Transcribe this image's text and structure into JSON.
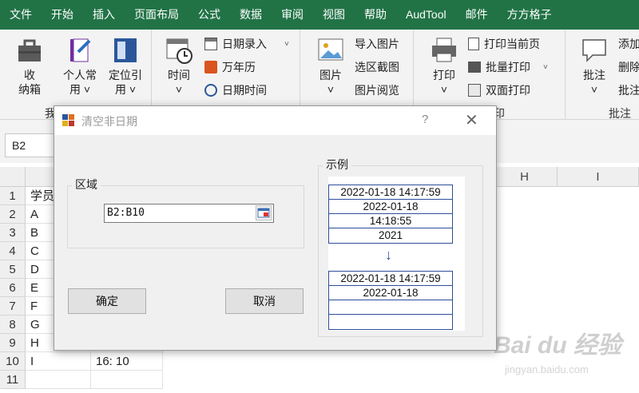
{
  "menu_tabs": [
    "文件",
    "开始",
    "插入",
    "页面布局",
    "公式",
    "数据",
    "审阅",
    "视图",
    "帮助",
    "AudTool",
    "邮件",
    "方方格子"
  ],
  "ribbon": {
    "toolbox": {
      "label": "收\n纳箱"
    },
    "personal": {
      "label": "个人常\n用 ˅"
    },
    "locate": {
      "label": "定位引\n用 ˅"
    },
    "group1_label": "我",
    "time": {
      "label": "时间\n˅"
    },
    "date_entry": "日期录入",
    "calendar": "万年历",
    "datetime": "日期时间",
    "picture": {
      "label": "图片\n˅"
    },
    "import_pic": "导入图片",
    "select_screenshot": "选区截图",
    "pic_browse": "图片阅览",
    "print": {
      "label": "打印\n˅"
    },
    "print_current": "打印当前页",
    "batch_print": "批量打印",
    "duplex_print": "双面打印",
    "print_group_label": "印",
    "comment": {
      "label": "批注\n˅"
    },
    "add": "添加",
    "delete": "删除",
    "comment_short": "批注",
    "comment_group_label": "批注"
  },
  "namebox": "B2",
  "columns": [
    "H",
    "I"
  ],
  "rows": [
    {
      "num": "1",
      "a": "学员",
      "b": ""
    },
    {
      "num": "2",
      "a": "A",
      "b": ""
    },
    {
      "num": "3",
      "a": "B",
      "b": ""
    },
    {
      "num": "4",
      "a": "C",
      "b": ""
    },
    {
      "num": "5",
      "a": "D",
      "b": ""
    },
    {
      "num": "6",
      "a": "E",
      "b": ""
    },
    {
      "num": "7",
      "a": "F",
      "b": ""
    },
    {
      "num": "8",
      "a": "G",
      "b": ""
    },
    {
      "num": "9",
      "a": "H",
      "b": ""
    },
    {
      "num": "10",
      "a": "I",
      "b": "16:  10"
    },
    {
      "num": "11",
      "a": "",
      "b": ""
    }
  ],
  "dialog": {
    "title": "清空非日期",
    "help": "?",
    "close": "✕",
    "region_legend": "区域",
    "range_value": "B2:B10",
    "ok": "确定",
    "cancel": "取消",
    "example_legend": "示例",
    "before": [
      "2022-01-18 14:17:59",
      "2022-01-18",
      "14:18:55",
      "2021"
    ],
    "arrow": "↓",
    "after": [
      "2022-01-18 14:17:59",
      "2022-01-18",
      "",
      ""
    ]
  },
  "watermark": {
    "text": "Bai du 经验",
    "sub": "jingyan.baidu.com"
  },
  "colors": {
    "ribbon_green": "#217346",
    "example_border": "#2e4f9b"
  }
}
